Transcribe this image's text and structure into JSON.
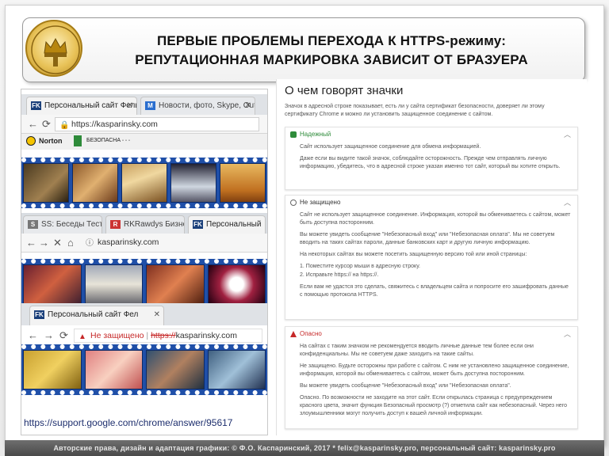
{
  "slide": {
    "title_line1": "ПЕРВЫЕ ПРОБЛЕМЫ ПЕРЕХОДА К HTTPS-режиму:",
    "title_line2": "РЕПУТАЦИОННАЯ МАРКИРОВКА ЗАВИСИТ ОТ БРАЗУЕРА",
    "caption": "https://support.google.com/chrome/answer/95617",
    "footer": "Авторские права, дизайн и адаптация графики: © Ф.О. Каспаринский, 2017 * felix@kasparinsky.pro, персональный сайт: kasparinsky.pro"
  },
  "browser1": {
    "tab1_label": "Персональный сайт Фели",
    "tab2_label": "Новости, фото, Skype, Out",
    "url": "https://kasparinsky.com",
    "norton_label": "Norton",
    "norton_status": "БЕЗОПАСНА"
  },
  "browser2": {
    "tab1_label": "SS: Беседы Тестирование",
    "tab2_label": "RKRawdys Бизнес",
    "tab3_label": "Персональный",
    "url": "kasparinsky.com"
  },
  "browser3": {
    "tab1_label": "Персональный сайт Фел",
    "not_secure_label": "Не защищено",
    "url_scheme": "https://",
    "url_host": "kasparinsky.com"
  },
  "right_panel": {
    "title": "О чем говорят значки",
    "intro": "Значок в адресной строке показывает, есть ли у сайта сертификат безопасности, доверяет ли этому сертификату Chrome и можно ли установить защищенное соединение с сайтом.",
    "cards": [
      {
        "heading": "Надежный",
        "color": "#2e8b3a",
        "p1": "Сайт использует защищенное соединение для обмена информацией.",
        "p2": "Даже если вы видите такой значок, соблюдайте осторожность. Прежде чем отправлять личную информацию, убедитесь, что в адресной строке указан именно тот сайт, который вы хотите открыть."
      },
      {
        "heading": "Не защищено",
        "color": "#666666",
        "p1": "Сайт не использует защищенное соединение. Информация, которой вы обмениваетесь с сайтом, может быть доступна посторонним.",
        "p2": "Вы можете увидеть сообщение \"Небезопасный вход\" или \"Небезопасная оплата\". Мы не советуем вводить на таких сайтах пароли, данные банковских карт и другую личную информацию.",
        "p3": "На некоторых сайтах вы можете посетить защищенную версию той или иной страницы:",
        "step1": "1. Поместите курсор мыши в адресную строку.",
        "step2": "2. Исправьте https:// на https://.",
        "p4": "Если вам не удастся это сделать, свяжитесь с владельцем сайта и попросите его зашифровать данные с помощью протокола HTTPS."
      },
      {
        "heading": "Опасно",
        "color": "#c62828",
        "p1": "На сайтах с таким значком не рекомендуется вводить личные данные тем более если они конфиденциальны. Мы не советуем даже заходить на такие сайты.",
        "p2": "Не защищено. Будьте осторожны при работе с сайтом. С ним не установлено защищенное соединение, информация, которой вы обмениваетесь с сайтом, может быть доступна посторонним.",
        "p3": "Вы можете увидеть сообщение \"Небезопасный вход\" или \"Небезопасная оплата\".",
        "p4": "Опасно. По возможности не заходите на этот сайт. Если открылась страница с предупреждением красного цвета, значит функция Безопасный просмотр (?) отметила сайт как небезопасный. Через него злоумышленники могут получить доступ к вашей личной информации."
      }
    ]
  }
}
